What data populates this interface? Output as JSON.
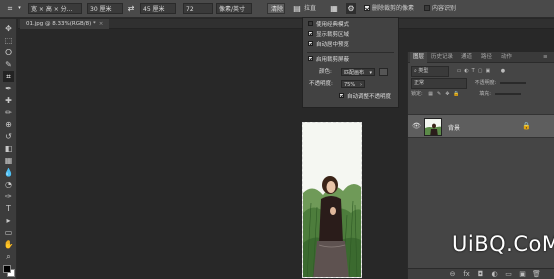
{
  "options_bar": {
    "tool_icon": "crop-icon",
    "ratio_select": "宽 × 高 × 分...",
    "width_value": "30 厘米",
    "swap_icon": "swap-icon",
    "height_value": "45 厘米",
    "resolution_value": "72",
    "resolution_unit": "像素/英寸",
    "clear_button": "清除",
    "straighten_label": "拉直",
    "delete_cropped_label": "删除裁剪的像素",
    "content_aware_label": "内容识别"
  },
  "document_tab": {
    "title": "01.jpg @ 8.33%(RGB/8) *",
    "close": "×"
  },
  "overlay_menu": {
    "items": [
      {
        "label": "使用经典模式",
        "checked": false
      },
      {
        "label": "显示裁剪区域",
        "checked": true
      },
      {
        "label": "自动居中预览",
        "checked": true
      },
      {
        "label": "启用裁剪屏蔽",
        "checked": true
      }
    ],
    "color_label": "颜色:",
    "color_value": "匹配画布",
    "opacity_label": "不透明度:",
    "opacity_value": "75%",
    "auto_adjust_label": "自动调整不透明度",
    "auto_adjust_checked": true
  },
  "layers_panel": {
    "tabs": [
      "图层",
      "历史记录",
      "通道",
      "路径",
      "动作"
    ],
    "active_tab": "图层",
    "filter_label": "类型",
    "blend_mode": "正常",
    "opacity_label": "不透明度:",
    "lock_label": "锁定:",
    "fill_label": "填充:",
    "layer_name": "背景",
    "footer_icons": [
      "link-icon",
      "fx-icon",
      "mask-icon",
      "adjustment-icon",
      "folder-icon",
      "new-layer-icon",
      "trash-icon"
    ],
    "footer_glyphs": [
      "⊖",
      "fx",
      "◘",
      "◐",
      "▭",
      "▣",
      "🗑"
    ]
  },
  "tools": [
    "move-icon",
    "marquee-icon",
    "lasso-icon",
    "quick-select-icon",
    "crop-icon",
    "eyedropper-icon",
    "healing-icon",
    "brush-icon",
    "stamp-icon",
    "history-brush-icon",
    "eraser-icon",
    "gradient-icon",
    "blur-icon",
    "dodge-icon",
    "pen-icon",
    "type-icon",
    "path-select-icon",
    "shape-icon",
    "hand-icon",
    "zoom-icon"
  ],
  "tool_glyphs": [
    "✥",
    "⬚",
    "ⵔ",
    "✎",
    "⌗",
    "✒",
    "✚",
    "✏",
    "⊕",
    "↺",
    "◧",
    "▦",
    "💧",
    "◔",
    "✑",
    "T",
    "▸",
    "▭",
    "✋",
    "⌕"
  ],
  "watermark": "UiBQ.CoM",
  "colors": {
    "options_bar": "#4a4a4a",
    "canvas_bg": "#282828",
    "panel_bg": "#454545",
    "menu_bg": "#424242"
  }
}
